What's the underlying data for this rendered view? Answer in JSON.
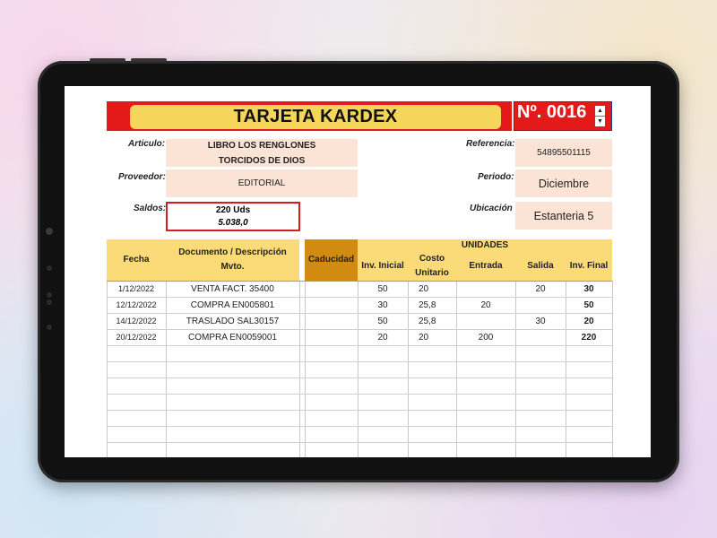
{
  "title": "TARJETA KARDEX",
  "number": "Nº. 0016",
  "spinner": {
    "up": "▲",
    "down": "▼"
  },
  "labels": {
    "articulo": "Articulo:",
    "proveedor": "Proveedor:",
    "saldos": "Saldos:",
    "referencia": "Referencia:",
    "periodo": "Periodo:",
    "ubicacion": "Ubicación"
  },
  "values": {
    "articulo_line1": "LIBRO LOS RENGLONES",
    "articulo_line2": "TORCIDOS DE DIOS",
    "proveedor": "EDITORIAL",
    "saldos_units": "220 Uds",
    "saldos_value": "5.038,0",
    "referencia": "54895501115",
    "periodo": "Diciembre",
    "ubicacion": "Estanteria 5"
  },
  "table": {
    "headers": {
      "fecha": "Fecha",
      "documento": "Documento / Descripción Mvto.",
      "caducidad": "Caducidad",
      "unidades": "UNIDADES",
      "inv_inicial": "Inv. Inicial",
      "costo_unitario": "Costo Unitario",
      "entrada": "Entrada",
      "salida": "Salida",
      "inv_final": "Inv. Final"
    },
    "rows": [
      {
        "fecha": "1/12/2022",
        "documento": "VENTA FACT. 35400",
        "caducidad": "",
        "inv_inicial": "50",
        "costo": "20",
        "entrada": "",
        "salida": "20",
        "inv_final": "30"
      },
      {
        "fecha": "12/12/2022",
        "documento": "COMPRA EN005801",
        "caducidad": "",
        "inv_inicial": "30",
        "costo": "25,8",
        "entrada": "20",
        "salida": "",
        "inv_final": "50"
      },
      {
        "fecha": "14/12/2022",
        "documento": "TRASLADO SAL30157",
        "caducidad": "",
        "inv_inicial": "50",
        "costo": "25,8",
        "entrada": "",
        "salida": "30",
        "inv_final": "20"
      },
      {
        "fecha": "20/12/2022",
        "documento": "COMPRA EN0059001",
        "caducidad": "",
        "inv_inicial": "20",
        "costo": "20",
        "entrada": "200",
        "salida": "",
        "inv_final": "220"
      }
    ]
  },
  "colors": {
    "title_red": "#e41a1a",
    "title_yellow": "#f6d55b",
    "field_peach": "#fbe3d6",
    "header_yellow": "#fbdb78",
    "caducidad_orange": "#d18b10",
    "saldos_border": "#d41e1e"
  }
}
